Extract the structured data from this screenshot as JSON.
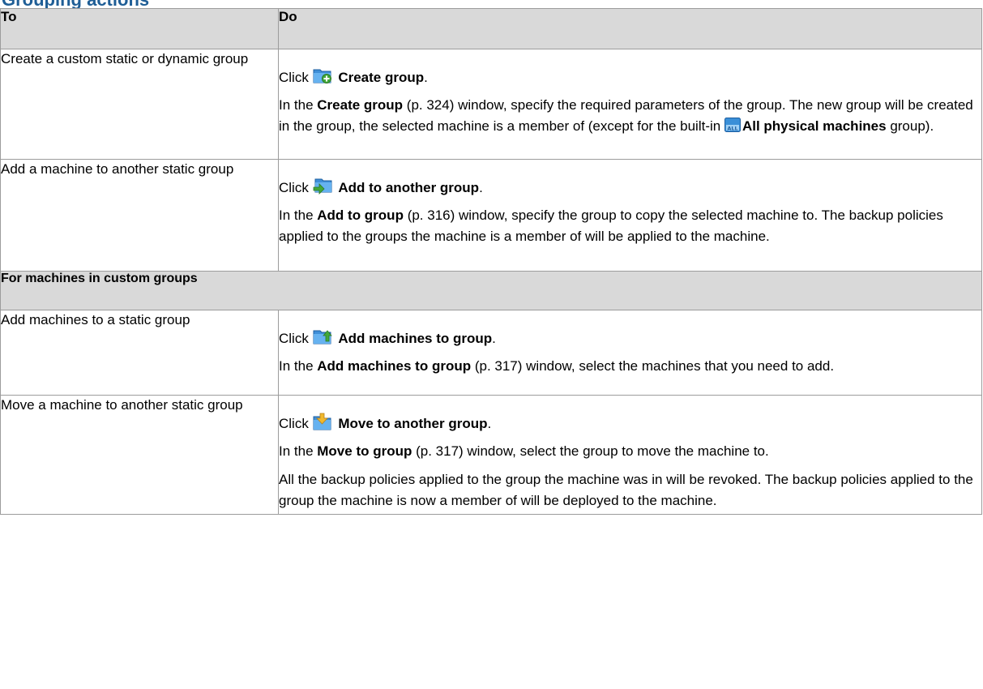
{
  "heading": "Grouping actions",
  "table": {
    "col_to": "To",
    "col_do": "Do",
    "section_label": "For machines in custom groups"
  },
  "rows": [
    {
      "to": "Create a custom static or dynamic group",
      "click_word": "Click",
      "action_icon": "create-group-icon",
      "action_label": "Create group",
      "period": ".",
      "p1_before": "In the ",
      "p1_bold": "Create group",
      "p1_after": " (p. 324) window, specify the required parameters of the group. The new group will be created in the group, the selected machine is a member of (except for the built-in ",
      "p1_icon": "all-physical-machines-icon",
      "p1_bold2": "All physical machines",
      "p1_end": " group)."
    },
    {
      "to": "Add a machine to another static group",
      "click_word": "Click",
      "action_icon": "add-to-group-icon",
      "action_label": "Add to another group",
      "period": ".",
      "p1_before": "In the ",
      "p1_bold": "Add to group",
      "p1_after": " (p. 316) window, specify the group to copy the selected machine to. The backup policies applied to the groups the machine is a member of will be applied to the machine."
    },
    {
      "to": "Add machines to a static group",
      "click_word": "Click",
      "action_icon": "add-machines-icon",
      "action_label": "Add machines to group",
      "period": ".",
      "p1_before": "In the ",
      "p1_bold": "Add machines to group",
      "p1_after": " (p. 317) window, select the machines that you need to add."
    },
    {
      "to": "Move a machine to another static group",
      "click_word": "Click",
      "action_icon": "move-to-group-icon",
      "action_label": "Move to another group",
      "period": ".",
      "p1_before": "In the ",
      "p1_bold": "Move to group",
      "p1_after": " (p. 317) window, select the group to move the machine to.",
      "p2": "All the backup policies applied to the group the machine was in will be revoked. The backup policies applied to the group the machine is now a member of will be deployed to the machine."
    }
  ]
}
